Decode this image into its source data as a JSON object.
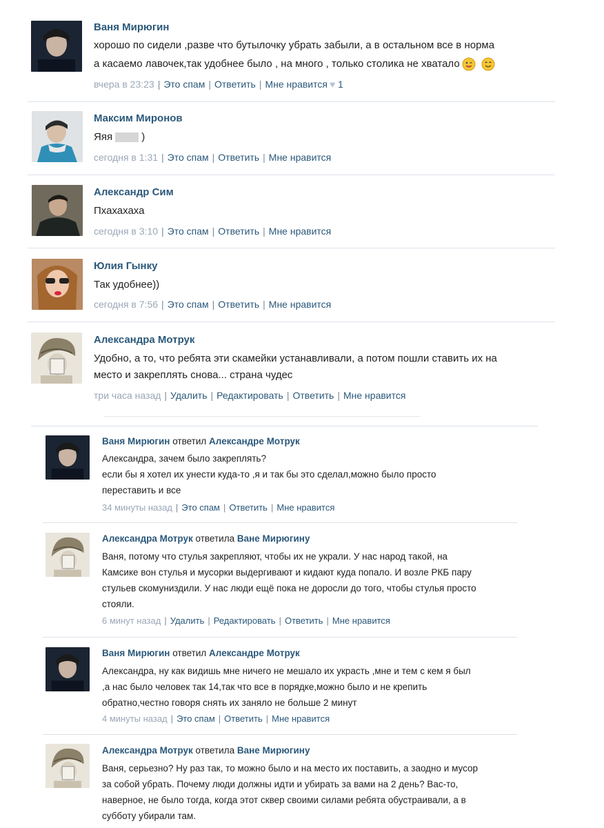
{
  "comments": [
    {
      "author": "Ваня Мирюгин",
      "lines": [
        "хорошо по сидели ,разве что бутылочку убрать забыли, а в остальном все в норма",
        "а касаемо лавочек,так удобнее было , на много , только столика не хватало"
      ],
      "date": "вчера в 23:23",
      "actions": [
        "Это спам",
        "Ответить",
        "Мне нравится"
      ],
      "likes": "1"
    },
    {
      "author": "Максим Миронов",
      "lines": [
        "Яяя",
        ")"
      ],
      "date": "сегодня в 1:31",
      "actions": [
        "Это спам",
        "Ответить",
        "Мне нравится"
      ]
    },
    {
      "author": "Александр Сим",
      "lines": [
        "Пхахахаха"
      ],
      "date": "сегодня в 3:10",
      "actions": [
        "Это спам",
        "Ответить",
        "Мне нравится"
      ]
    },
    {
      "author": "Юлия Гынку",
      "lines": [
        "Так удобнее))"
      ],
      "date": "сегодня в 7:56",
      "actions": [
        "Это спам",
        "Ответить",
        "Мне нравится"
      ]
    },
    {
      "author": "Александра Мотрук",
      "lines": [
        "Удобно, а то, что ребята эти скамейки устанавливали, а потом пошли ставить их на",
        "место и закреплять снова... страна чудес"
      ],
      "date": "три часа назад",
      "actions": [
        "Удалить",
        "Редактировать",
        "Ответить",
        "Мне нравится"
      ]
    }
  ],
  "replies": [
    {
      "author": "Ваня Мирюгин",
      "verb": "ответил",
      "target": "Александре Мотрук",
      "lines": [
        "Александра, зачем было закреплять?",
        "если бы я хотел их унести куда-то ,я и так бы это сделал,можно было просто",
        "переставить и все"
      ],
      "date": "34 минуты назад",
      "actions": [
        "Это спам",
        "Ответить",
        "Мне нравится"
      ]
    },
    {
      "author": "Александра Мотрук",
      "verb": "ответила",
      "target": "Ване Мирюгину",
      "lines": [
        "Ваня, потому что стулья закрепляют, чтобы их не украли. У нас народ такой, на",
        "Камсике вон стулья и мусорки выдергивают и кидают куда попало. И возле РКБ пару",
        "стульев скомуниздили. У нас люди ещё пока не доросли до того, чтобы стулья просто",
        "стояли."
      ],
      "date": "6 минут назад",
      "actions": [
        "Удалить",
        "Редактировать",
        "Ответить",
        "Мне нравится"
      ]
    },
    {
      "author": "Ваня Мирюгин",
      "verb": "ответил",
      "target": "Александре Мотрук",
      "lines": [
        "Александра, ну как видишь мне ничего не мешало их украсть ,мне и тем с кем я был",
        ",а нас было человек так 14,так что все в порядке,можно было и не крепить",
        "обратно,честно говоря снять их заняло не больше 2 минут"
      ],
      "date": "4 минуты назад",
      "actions": [
        "Это спам",
        "Ответить",
        "Мне нравится"
      ]
    },
    {
      "author": "Александра Мотрук",
      "verb": "ответила",
      "target": "Ване Мирюгину",
      "lines": [
        "Ваня, серьезно? Ну раз так, то можно было и на место их поставить, а заодно и мусор",
        "за собой убрать. Почему люди должны идти и убирать за вами на 2 день? Вас-то,",
        "наверное, не было тогда, когда этот сквер своими силами ребята обустраивали, а в",
        "субботу убирали там."
      ]
    }
  ],
  "colors": {
    "link": "#2b587a",
    "date": "#9aa7b6",
    "divider": "#dbe2ea"
  }
}
